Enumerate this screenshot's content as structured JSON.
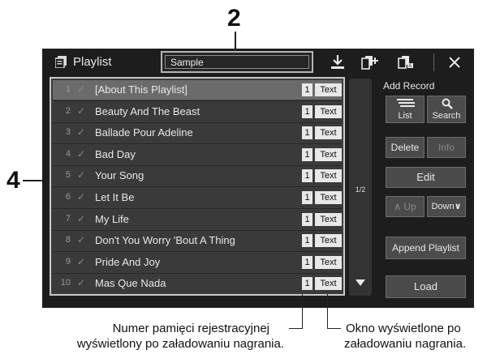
{
  "callouts": {
    "n2": "2",
    "n4": "4"
  },
  "window": {
    "title": "Playlist",
    "playlist_name": "Sample"
  },
  "toolbar": {
    "icons": [
      "save-icon",
      "new-playlist-icon",
      "rename-icon",
      "close-icon"
    ]
  },
  "records": [
    {
      "num": "1",
      "check": "✓",
      "title": "[About This Playlist]",
      "memory": "1",
      "text": "Text",
      "selected": true
    },
    {
      "num": "2",
      "check": "✓",
      "title": "Beauty And The Beast",
      "memory": "1",
      "text": "Text"
    },
    {
      "num": "3",
      "check": "✓",
      "title": "Ballade Pour Adeline",
      "memory": "1",
      "text": "Text"
    },
    {
      "num": "4",
      "check": "✓",
      "title": "Bad Day",
      "memory": "1",
      "text": "Text"
    },
    {
      "num": "5",
      "check": "✓",
      "title": "Your Song",
      "memory": "1",
      "text": "Text"
    },
    {
      "num": "6",
      "check": "✓",
      "title": "Let It Be",
      "memory": "1",
      "text": "Text"
    },
    {
      "num": "7",
      "check": "✓",
      "title": "My Life",
      "memory": "1",
      "text": "Text"
    },
    {
      "num": "8",
      "check": "✓",
      "title": "Don't You Worry 'Bout A Thing",
      "memory": "1",
      "text": "Text"
    },
    {
      "num": "9",
      "check": "✓",
      "title": "Pride And Joy",
      "memory": "1",
      "text": "Text"
    },
    {
      "num": "10",
      "check": "✓",
      "title": "Mas Que Nada",
      "memory": "1",
      "text": "Text"
    }
  ],
  "scroll": {
    "page": "1/2"
  },
  "side": {
    "add_record": "Add Record",
    "list": "List",
    "search": "Search",
    "delete": "Delete",
    "info": "Info",
    "edit": "Edit",
    "up": "Up",
    "down": "Down",
    "append": "Append Playlist",
    "load": "Load"
  },
  "captions": {
    "left_line1": "Numer pamięci rejestracyjnej",
    "left_line2": "wyświetlony po załadowaniu nagrania.",
    "right_line1": "Okno wyświetlone po",
    "right_line2": "załadowaniu nagrania."
  }
}
